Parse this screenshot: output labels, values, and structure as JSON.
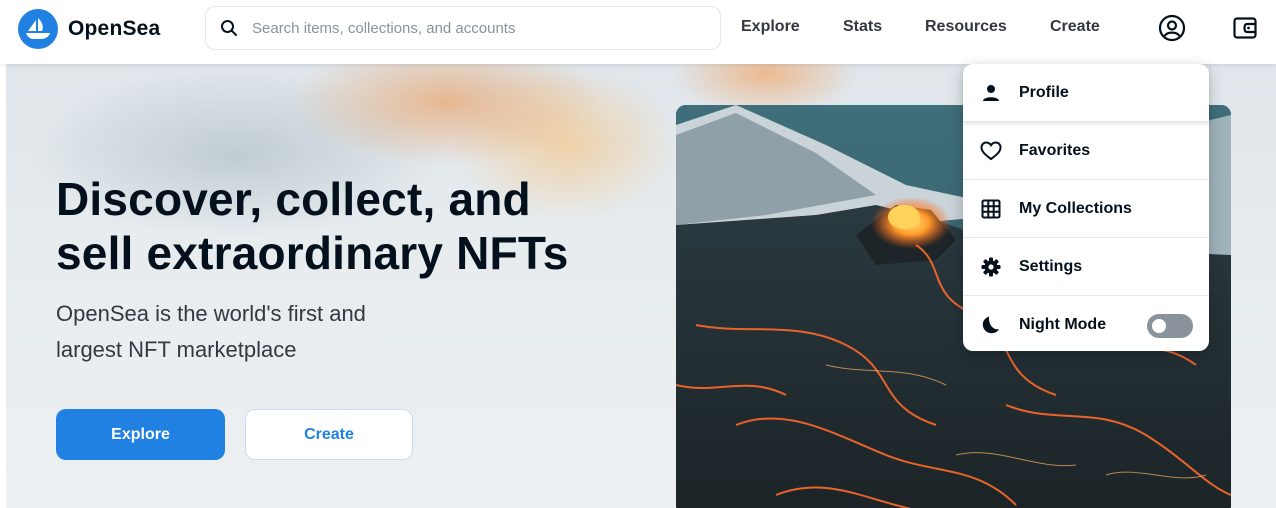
{
  "brand": {
    "name": "OpenSea",
    "color": "#2081e2",
    "logo_icon": "boat-logo-icon"
  },
  "search": {
    "placeholder": "Search items, collections, and accounts",
    "value": "",
    "icon": "search-icon"
  },
  "nav": {
    "links": [
      "Explore",
      "Stats",
      "Resources",
      "Create"
    ],
    "account_icon": "account-circle-icon",
    "wallet_icon": "wallet-icon"
  },
  "hero": {
    "title_line1": "Discover, collect, and",
    "title_line2": "sell extraordinary NFTs",
    "subtitle_line1": "OpenSea is the world's first and",
    "subtitle_line2": "largest NFT marketplace",
    "primary_button": "Explore",
    "secondary_button": "Create",
    "image": "volcano-lava-artwork"
  },
  "account_menu": {
    "items": [
      {
        "label": "Profile",
        "icon": "person-icon"
      },
      {
        "label": "Favorites",
        "icon": "heart-icon"
      },
      {
        "label": "My Collections",
        "icon": "grid-icon"
      },
      {
        "label": "Settings",
        "icon": "gear-icon"
      },
      {
        "label": "Night Mode",
        "icon": "moon-icon"
      }
    ],
    "night_mode_enabled": false
  },
  "colors": {
    "accent": "#2081e2",
    "text": "#04111d",
    "toggle_off": "#8a939b"
  }
}
